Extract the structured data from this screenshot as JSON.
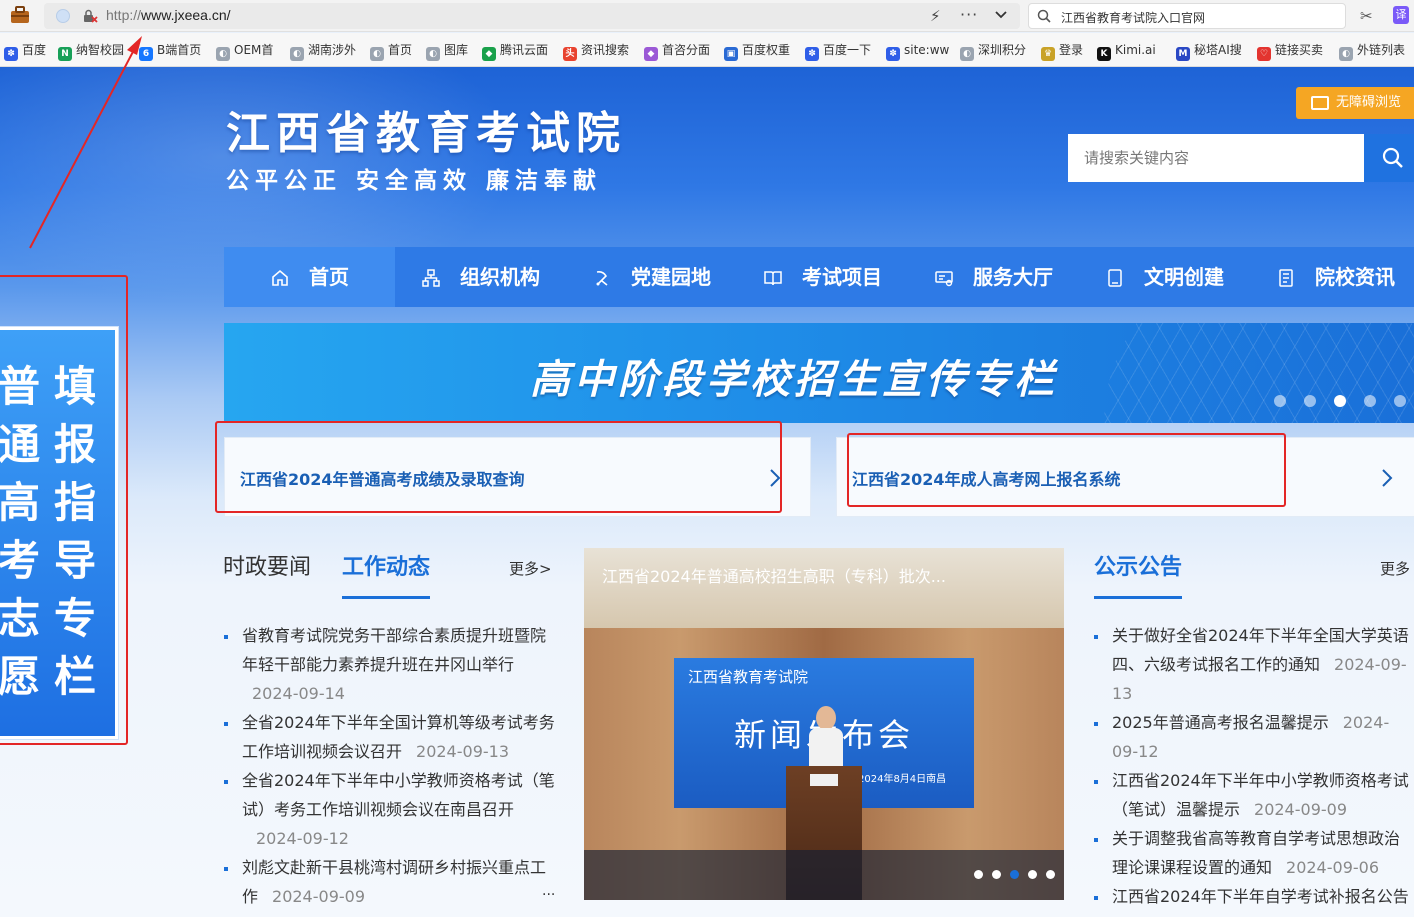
{
  "browser": {
    "url_protocol": "http://",
    "url_host": "www.jxeea.cn/",
    "search_text": "江西省教育考试院入口官网",
    "translate_label": "译",
    "bookmarks": [
      {
        "label": "百度",
        "color": "#2f5ee8",
        "glyph": "✽"
      },
      {
        "label": "纳智校园",
        "color": "#18a058",
        "glyph": "N"
      },
      {
        "label": "B端首页",
        "color": "#1677ff",
        "glyph": "6"
      },
      {
        "label": "OEM首",
        "color": "#9aa4b0",
        "glyph": "◐"
      },
      {
        "label": "湖南涉外",
        "color": "#9aa4b0",
        "glyph": "◐"
      },
      {
        "label": "首页",
        "color": "#9aa4b0",
        "glyph": "◐"
      },
      {
        "label": "图库",
        "color": "#9aa4b0",
        "glyph": "◐"
      },
      {
        "label": "腾讯云面",
        "color": "#1aa14b",
        "glyph": "◆"
      },
      {
        "label": "资讯搜索",
        "color": "#e8432f",
        "glyph": "头"
      },
      {
        "label": "首咨分面",
        "color": "#9b59d6",
        "glyph": "◆"
      },
      {
        "label": "百度权重",
        "color": "#2a6ad4",
        "glyph": "▣"
      },
      {
        "label": "百度一下",
        "color": "#2f5ee8",
        "glyph": "✽"
      },
      {
        "label": "site:ww",
        "color": "#2f5ee8",
        "glyph": "✽"
      },
      {
        "label": "深圳积分",
        "color": "#9aa4b0",
        "glyph": "◐"
      },
      {
        "label": "登录",
        "color": "#c9a227",
        "glyph": "♛"
      },
      {
        "label": "Kimi.ai",
        "color": "#111111",
        "glyph": "K"
      },
      {
        "label": "秘塔AI搜",
        "color": "#2a48c4",
        "glyph": "M"
      },
      {
        "label": "链接买卖",
        "color": "#e3342f",
        "glyph": "♡"
      },
      {
        "label": "外链列表",
        "color": "#9aa4b0",
        "glyph": "◐"
      }
    ]
  },
  "site": {
    "title": "江西省教育考试院",
    "motto": "公平公正  安全高效  廉洁奉献",
    "accessibility_label": "无障碍浏览",
    "search_placeholder": "请搜索关键内容"
  },
  "nav": [
    {
      "label": "首页"
    },
    {
      "label": "组织机构"
    },
    {
      "label": "党建园地"
    },
    {
      "label": "考试项目"
    },
    {
      "label": "服务大厅"
    },
    {
      "label": "文明创建"
    },
    {
      "label": "院校资讯"
    }
  ],
  "banner": {
    "text": "高中阶段学校招生宣传专栏",
    "dots": 5,
    "active_dot": 3
  },
  "quick_links": [
    {
      "label": "江西省2024年普通高考成绩及录取查询"
    },
    {
      "label": "江西省2024年成人高考网上报名系统"
    }
  ],
  "left_panel": {
    "col1": "普通高考志愿",
    "col2": "填报指导专栏"
  },
  "news": {
    "tab_inactive": "时政要闻",
    "tab_active": "工作动态",
    "more": "更多>",
    "items": [
      {
        "title": "省教育考试院党务干部综合素质提升班暨院年轻干部能力素养提升班在井冈山举行",
        "date": "2024-09-14"
      },
      {
        "title": "全省2024年下半年全国计算机等级考试考务工作培训视频会议召开",
        "date": "2024-09-13"
      },
      {
        "title": "全省2024年下半年中小学教师资格考试（笔试）考务工作培训视频会议在南昌召开",
        "date": "2024-09-12"
      },
      {
        "title": "刘彪文赴新干县桃湾村调研乡村振兴重点工作",
        "date": "2024-09-09"
      }
    ],
    "ellipsis": "..."
  },
  "photo": {
    "screen_org": "江西省教育考试院",
    "screen_title": "新闻发布会",
    "screen_date": "2024年8月4日南昌",
    "caption": "江西省2024年普通高校招生高职（专科）批次...",
    "dots": 5,
    "active_dot": 3
  },
  "notices": {
    "title": "公示公告",
    "more": "更多",
    "items": [
      {
        "title": "关于做好全省2024年下半年全国大学英语四、六级考试报名工作的通知",
        "date": "2024-09-13"
      },
      {
        "title": "2025年普通高考报名温馨提示",
        "date": "2024-09-12"
      },
      {
        "title": "江西省2024年下半年中小学教师资格考试（笔试）温馨提示",
        "date": "2024-09-09"
      },
      {
        "title": "关于调整我省高等教育自学考试思想政治理论课课程设置的通知",
        "date": "2024-09-06"
      },
      {
        "title": "江西省2024年下半年自学考试补报名公告",
        "date": ""
      }
    ]
  }
}
